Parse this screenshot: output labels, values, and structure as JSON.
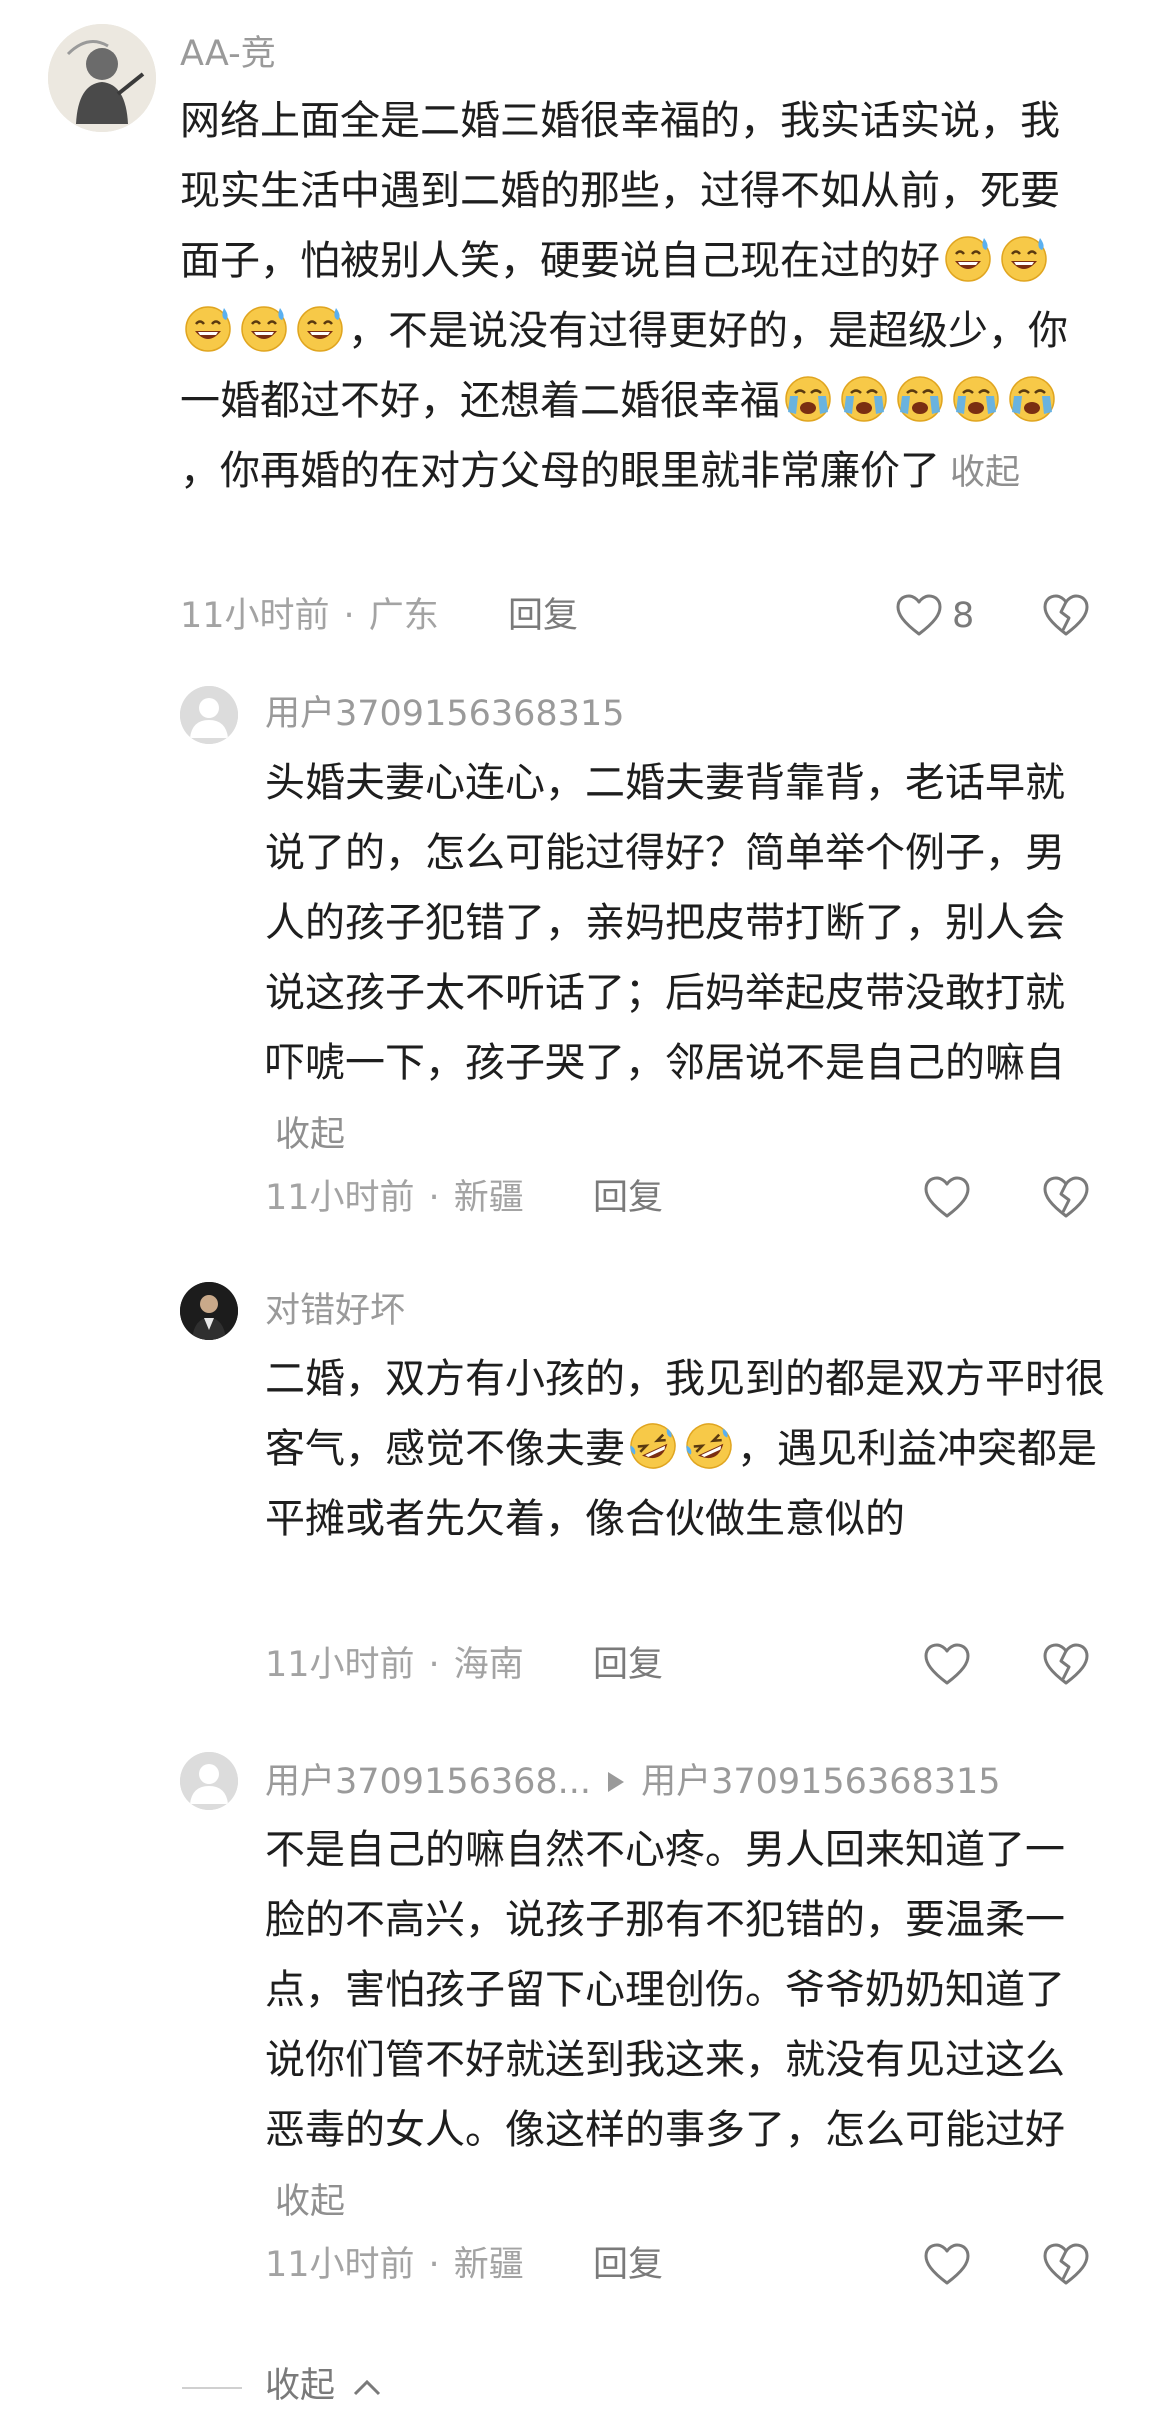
{
  "comments": [
    {
      "username": "AA-竞",
      "text_parts": [
        "网络上面全是二婚三婚很幸福的，我实话实说，我现实生活中遇到二婚的那些，过得不如从前，死要面子，怕被别人笑，硬要说自己现在过的好",
        "，不是说没有过得更好的，是超级少，你一婚都过不好，还想着二婚很幸福",
        "，你再婚的在对方父母的眼里就非常廉价了"
      ],
      "collapse_label": "收起",
      "time": "11小时前",
      "location": "广东",
      "reply_label": "回复",
      "likes": "8",
      "icons": [
        "heart-icon",
        "dislike-heart-icon"
      ]
    },
    {
      "username": "用户3709156368315",
      "text": "头婚夫妻心连心，二婚夫妻背靠背，老话早就说了的，怎么可能过得好？简单举个例子，男人的孩子犯错了，亲妈把皮带打断了，别人会说这孩子太不听话了；后妈举起皮带没敢打就吓唬一下，孩子哭了，邻居说不是自己的嘛自",
      "collapse_label": "收起",
      "time": "11小时前",
      "location": "新疆",
      "reply_label": "回复"
    },
    {
      "username": "对错好坏",
      "text_parts": [
        "二婚，双方有小孩的，我见到的都是双方平时很客气，感觉不像夫妻",
        "，遇见利益冲突都是平摊或者先欠着，像合伙做生意似的"
      ],
      "time": "11小时前",
      "location": "海南",
      "reply_label": "回复"
    },
    {
      "username": "用户3709156368...",
      "reply_to": "用户3709156368315",
      "text": "不是自己的嘛自然不心疼。男人回来知道了一脸的不高兴，说孩子那有不犯错的，要温柔一点，害怕孩子留下心理创伤。爷爷奶奶知道了说你们管不好就送到我这来，就没有见过这么恶毒的女人。像这样的事多了，怎么可能过好",
      "collapse_label": "收起",
      "time": "11小时前",
      "location": "新疆",
      "reply_label": "回复"
    }
  ],
  "footer": {
    "collapse_label": "收起"
  },
  "colors": {
    "emoji_face": "#F7C948",
    "emoji_tear": "#5AB0F0",
    "icon_gray": "#7a7a7a"
  }
}
